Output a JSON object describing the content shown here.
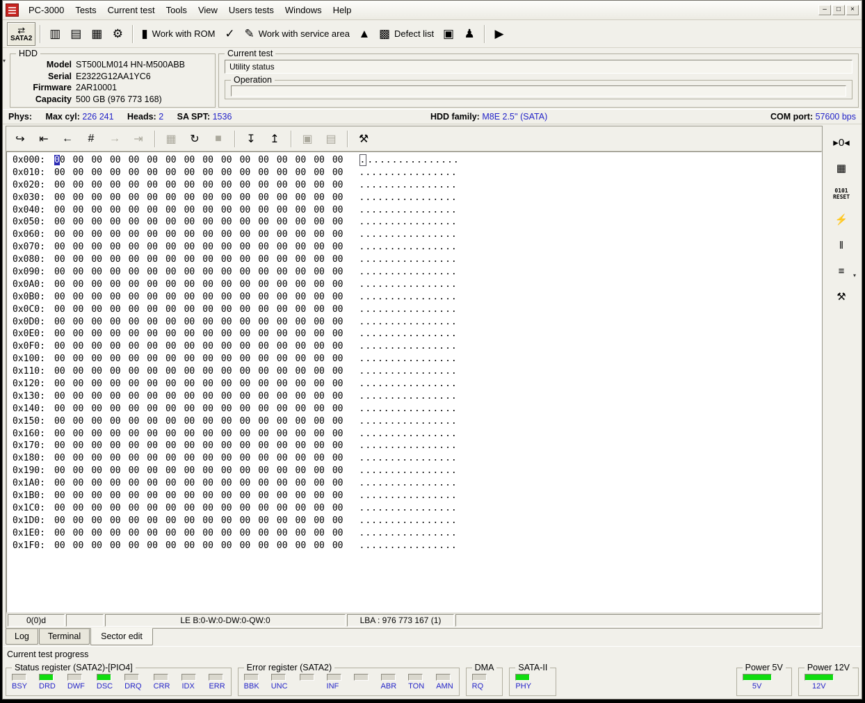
{
  "window": {
    "controls": {
      "minimize": "–",
      "restore": "□",
      "close": "×"
    }
  },
  "menu": {
    "items": [
      "PC-3000",
      "Tests",
      "Current test",
      "Tools",
      "View",
      "Users tests",
      "Windows",
      "Help"
    ]
  },
  "main_toolbar": {
    "items": [
      {
        "kind": "sata",
        "name": "sata2-button",
        "icon": "⇄",
        "label": "SATA2"
      },
      {
        "kind": "sep"
      },
      {
        "kind": "button",
        "name": "rom-chip-button",
        "icon": "▥"
      },
      {
        "kind": "button",
        "name": "drive-id-button",
        "icon": "▤"
      },
      {
        "kind": "button",
        "name": "firmware-chip-button",
        "icon": "▦"
      },
      {
        "kind": "button",
        "name": "gears-button",
        "icon": "⚙"
      },
      {
        "kind": "sep"
      },
      {
        "kind": "button",
        "name": "work-with-rom-button",
        "icon": "▮",
        "label": "Work with ROM"
      },
      {
        "kind": "button",
        "name": "test-check-button",
        "icon": "✓"
      },
      {
        "kind": "button",
        "name": "work-with-service-area-button",
        "icon": "✎",
        "label": "Work with service area"
      },
      {
        "kind": "button",
        "name": "graph-button",
        "icon": "▲"
      },
      {
        "kind": "button",
        "name": "defect-list-button",
        "icon": "▩",
        "label": "Defect list"
      },
      {
        "kind": "button",
        "name": "copy-pages-button",
        "icon": "▣"
      },
      {
        "kind": "button",
        "name": "user-profile-button",
        "icon": "♟"
      },
      {
        "kind": "sep"
      },
      {
        "kind": "button",
        "name": "play-button",
        "icon": "▶"
      }
    ]
  },
  "hdd": {
    "group_label": "HDD",
    "collapse_glyph": "▾",
    "fields": [
      {
        "label": "Model",
        "value": "ST500LM014 HN-M500ABB"
      },
      {
        "label": "Serial",
        "value": "E2322G12AA1YC6"
      },
      {
        "label": "Firmware",
        "value": "2AR10001"
      },
      {
        "label": "Capacity",
        "value": "500 GB (976 773 168)"
      }
    ]
  },
  "current_test": {
    "group_label": "Current test",
    "status": "Utility status",
    "operation_label": "Operation"
  },
  "phys_bar": {
    "phys_label": "Phys:",
    "max_cyl_label": "Max cyl:",
    "max_cyl": "226 241",
    "heads_label": "Heads:",
    "heads": "2",
    "sa_spt_label": "SA SPT:",
    "sa_spt": "1536",
    "hdd_family_label": "HDD family:",
    "hdd_family": "M8E 2.5'' (SATA)",
    "com_port_label": "COM port:",
    "com_port": "57600 bps"
  },
  "hex_toolbar": {
    "items": [
      {
        "kind": "button",
        "name": "exit-sector-edit-button",
        "icon": "↪"
      },
      {
        "kind": "button",
        "name": "first-sector-button",
        "icon": "⇤"
      },
      {
        "kind": "button",
        "name": "prev-sector-button",
        "icon": "←"
      },
      {
        "kind": "button",
        "name": "goto-sector-button",
        "icon": "#"
      },
      {
        "kind": "button",
        "name": "next-sector-button",
        "icon": "→",
        "disabled": true
      },
      {
        "kind": "button",
        "name": "last-sector-button",
        "icon": "⇥",
        "disabled": true
      },
      {
        "kind": "sep"
      },
      {
        "kind": "button",
        "name": "save-sector-button",
        "icon": "▦",
        "disabled": true
      },
      {
        "kind": "button",
        "name": "refresh-options-button",
        "icon": "↻"
      },
      {
        "kind": "button",
        "name": "stop-button",
        "icon": "■",
        "disabled": true
      },
      {
        "kind": "sep"
      },
      {
        "kind": "button",
        "name": "read-sectors-button",
        "icon": "↧"
      },
      {
        "kind": "button",
        "name": "write-sectors-button",
        "icon": "↥"
      },
      {
        "kind": "sep"
      },
      {
        "kind": "button",
        "name": "copy-button",
        "icon": "▣",
        "disabled": true
      },
      {
        "kind": "button",
        "name": "paste-button",
        "icon": "▤",
        "disabled": true
      },
      {
        "kind": "sep"
      },
      {
        "kind": "button",
        "name": "edit-tools-button",
        "icon": "⚒"
      }
    ]
  },
  "right_toolbar": {
    "items": [
      {
        "kind": "button",
        "name": "skip-to-zero-button",
        "glyph": "▸0◂"
      },
      {
        "kind": "button",
        "name": "ata-registers-button",
        "glyph": "▦"
      },
      {
        "kind": "reset",
        "name": "reset-button",
        "top": "0101",
        "bottom": "RESET"
      },
      {
        "kind": "button",
        "name": "power-switch-button",
        "glyph": "⚡"
      },
      {
        "kind": "button",
        "name": "pause-button",
        "glyph": "‖"
      },
      {
        "kind": "dropdown",
        "name": "modes-button",
        "glyph": "≡",
        "caret": "▾"
      },
      {
        "kind": "button",
        "name": "tools-button",
        "glyph": "⚒"
      }
    ]
  },
  "hex_editor": {
    "row_count": 32,
    "address_start": 0,
    "address_step": 16,
    "byte": "00",
    "bytes_per_row": 16,
    "ascii_char": ".",
    "status": {
      "left": "0(0)d",
      "le": "LE B:0-W:0-DW:0-QW:0",
      "lba": "LBA : 976 773 167 (1)"
    }
  },
  "tabs": {
    "items": [
      "Log",
      "Terminal",
      "Sector edit"
    ],
    "active": "Sector edit"
  },
  "progress_label": "Current test progress",
  "status_panel": {
    "colors": {
      "on": "#10dc10",
      "off": "#d9d7cd"
    },
    "groups": [
      {
        "label": "Status register (SATA2)-[PIO4]",
        "leds": [
          {
            "name": "BSY",
            "on": false
          },
          {
            "name": "DRD",
            "on": true
          },
          {
            "name": "DWF",
            "on": false
          },
          {
            "name": "DSC",
            "on": true
          },
          {
            "name": "DRQ",
            "on": false
          },
          {
            "name": "CRR",
            "on": false
          },
          {
            "name": "IDX",
            "on": false
          },
          {
            "name": "ERR",
            "on": false
          }
        ]
      },
      {
        "label": "Error register (SATA2)",
        "leds": [
          {
            "name": "BBK",
            "on": false
          },
          {
            "name": "UNC",
            "on": false
          },
          {
            "name": "",
            "on": false
          },
          {
            "name": "INF",
            "on": false
          },
          {
            "name": "",
            "on": false
          },
          {
            "name": "ABR",
            "on": false
          },
          {
            "name": "TON",
            "on": false
          },
          {
            "name": "AMN",
            "on": false
          }
        ]
      },
      {
        "label": "DMA",
        "leds": [
          {
            "name": "RQ",
            "on": false
          }
        ]
      },
      {
        "label": "SATA-II",
        "leds": [
          {
            "name": "PHY",
            "on": true
          }
        ]
      },
      {
        "label": "Power 5V",
        "wide": true,
        "push_right": true,
        "leds": [
          {
            "name": "5V",
            "on": true
          }
        ]
      },
      {
        "label": "Power 12V",
        "wide": true,
        "leds": [
          {
            "name": "12V",
            "on": true
          }
        ]
      }
    ]
  }
}
